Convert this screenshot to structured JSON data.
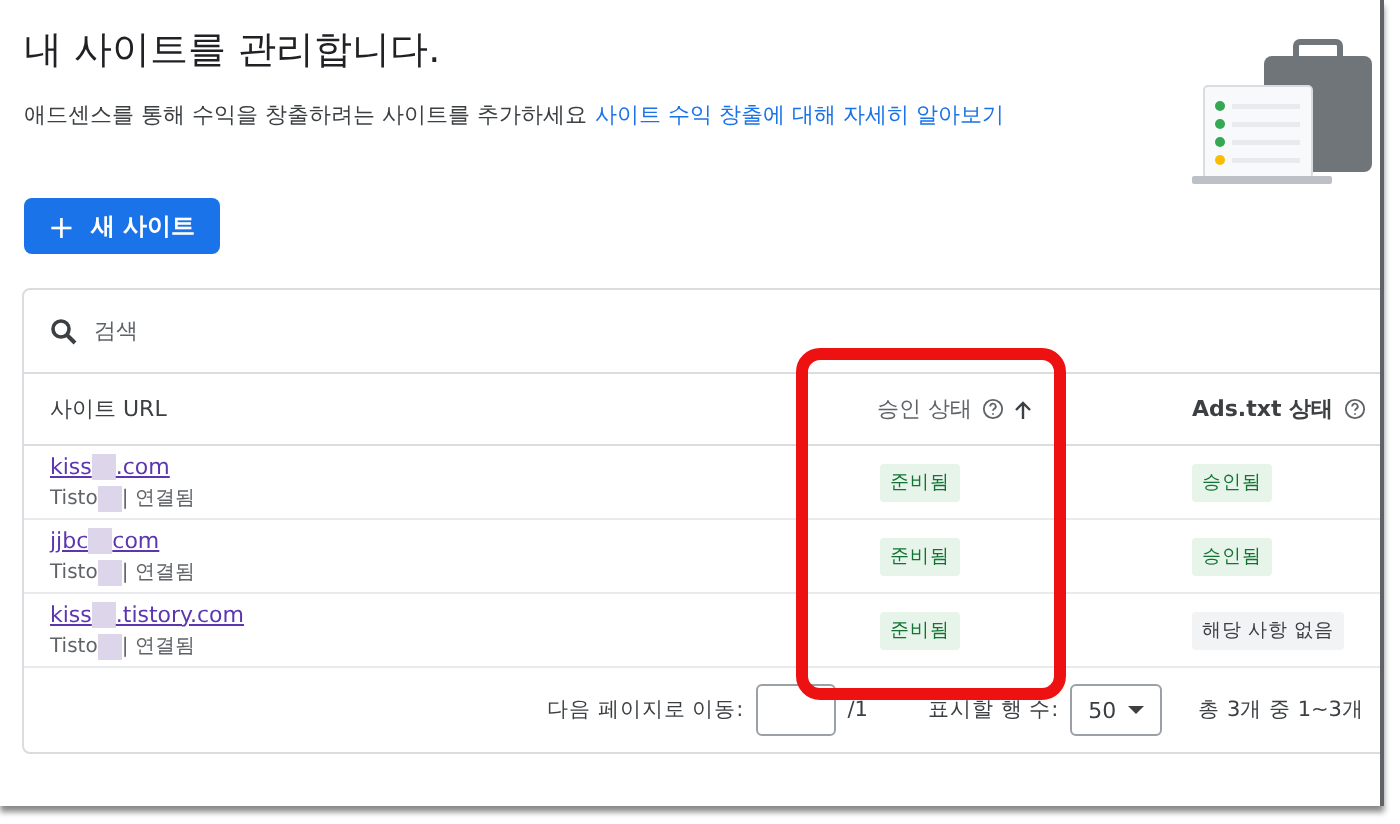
{
  "page": {
    "title": "내 사이트를 관리합니다.",
    "subtitle": "애드센스를 통해 수익을 창출하려는 사이트를 추가하세요",
    "learn_more_link": "사이트 수익 창출에 대해 자세히 알아보기"
  },
  "new_site_button": {
    "icon": "+",
    "label": "새 사이트"
  },
  "table": {
    "search": {
      "placeholder": "검색"
    },
    "columns": [
      {
        "label": "사이트 URL",
        "help": false,
        "sorted": false
      },
      {
        "label": "승인 상태",
        "help": true,
        "sorted": true
      },
      {
        "label": "Ads.txt 상태",
        "help": true,
        "sorted": false
      }
    ],
    "rows": [
      {
        "url_start": "kiss",
        "url_end": ".com",
        "source_start": "Tisto",
        "source_end": "| 연결됨",
        "approval": {
          "label": "준비됨",
          "kind": "ok"
        },
        "ads_txt": {
          "label": "승인됨",
          "kind": "ok"
        }
      },
      {
        "url_start": "jjbc",
        "url_end": "com",
        "source_start": "Tisto",
        "source_end": "| 연결됨",
        "approval": {
          "label": "준비됨",
          "kind": "ok"
        },
        "ads_txt": {
          "label": "승인됨",
          "kind": "ok"
        }
      },
      {
        "url_start": "kiss",
        "url_end": ".tistory.com",
        "source_start": "Tisto",
        "source_end": "| 연결됨",
        "approval": {
          "label": "준비됨",
          "kind": "ok"
        },
        "ads_txt": {
          "label": "해당 사항 없음",
          "kind": "neutral"
        }
      }
    ],
    "footer": {
      "goto_label": "다음 페이지로 이동:",
      "page_total": "/1",
      "rows_label": "표시할 행 수:",
      "rows_per_page": "50",
      "range": "총 3개 중 1~3개"
    }
  }
}
